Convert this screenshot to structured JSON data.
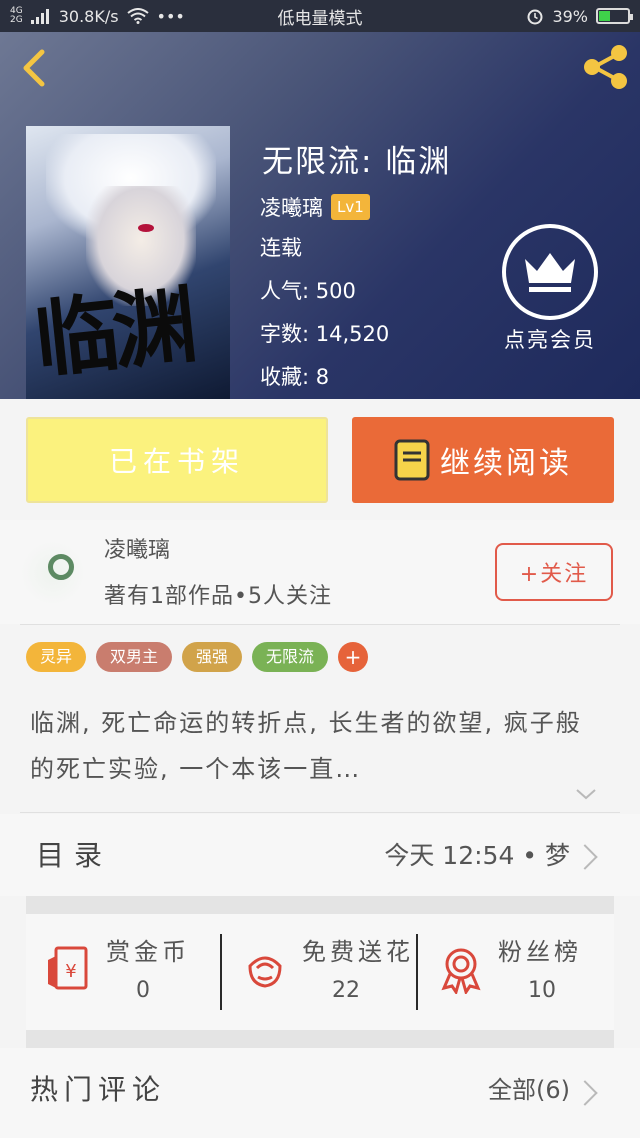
{
  "status_bar": {
    "network_top": "4G",
    "network_bottom": "2G",
    "speed": "30.8K/s",
    "mode": "低电量模式",
    "battery": "39%",
    "battery_level": 0.39
  },
  "header": {
    "cover_text": "临渊",
    "title": "无限流: 临渊",
    "author": "凌曦璃",
    "level": "Lv1",
    "status": "连载",
    "popularity": "人气: 500",
    "word_count": "字数: 14,520",
    "favorites": "收藏: 8",
    "vip_label": "点亮会员"
  },
  "actions": {
    "shelf_label": "已在书架",
    "read_label": "继续阅读"
  },
  "author_card": {
    "name": "凌曦璃",
    "stats": "著有1部作品•5人关注",
    "follow_label": "+关注"
  },
  "tags": [
    {
      "label": "灵异",
      "color": "#f3b53a"
    },
    {
      "label": "双男主",
      "color": "#c97d6e"
    },
    {
      "label": "强强",
      "color": "#d1a34a"
    },
    {
      "label": "无限流",
      "color": "#7ab255"
    }
  ],
  "description": "临渊, 死亡命运的转折点, 长生者的欲望, 疯子般的死亡实验, 一个本该一直…",
  "toc": {
    "label": "目录",
    "update": "今天 12:54 • 梦"
  },
  "stats": [
    {
      "title": "赏金币",
      "value": "0",
      "icon": "red-envelope-icon"
    },
    {
      "title": "免费送花",
      "value": "22",
      "icon": "flower-icon"
    },
    {
      "title": "粉丝榜",
      "value": "10",
      "icon": "medal-icon"
    }
  ],
  "comments": {
    "title": "热门评论",
    "all_label": "全部(6)"
  }
}
